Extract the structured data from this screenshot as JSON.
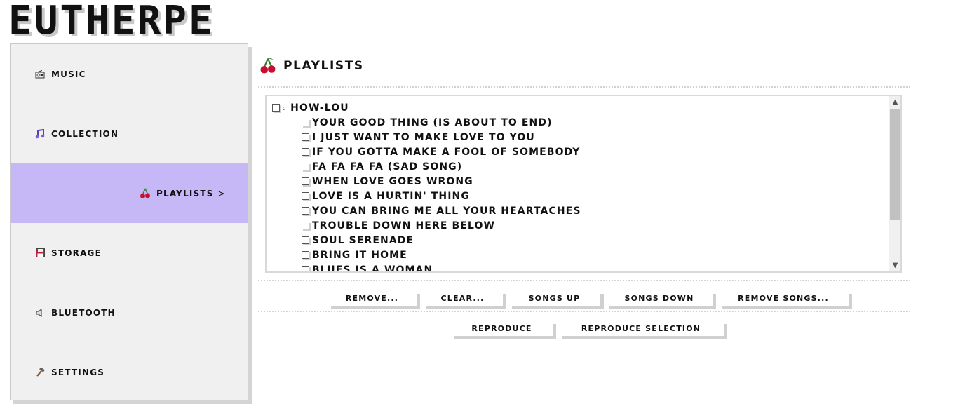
{
  "app": {
    "logo": "EUTHERPE"
  },
  "sidebar": {
    "items": [
      {
        "label": "Music",
        "icon": "radio-icon"
      },
      {
        "label": "Collection",
        "icon": "music-notes-icon"
      },
      {
        "label": "Playlists",
        "icon": "cherries-icon",
        "active": true,
        "arrow": ">"
      },
      {
        "label": "Storage",
        "icon": "floppy-disk-icon"
      },
      {
        "label": "Bluetooth",
        "icon": "speaker-icon"
      },
      {
        "label": "Settings",
        "icon": "hammer-icon"
      }
    ]
  },
  "main": {
    "title": "Playlists",
    "title_icon": "cherries-icon",
    "playlist": {
      "name": "How-Lou",
      "flat_glyph": "♭",
      "songs": [
        "Your Good Thing (Is About To End)",
        "I Just Want To Make Love To You",
        "If You Gotta Make A Fool Of Somebody",
        "Fa Fa Fa Fa (Sad Song)",
        "When Love Goes Wrong",
        "Love Is A Hurtin' Thing",
        "You Can Bring Me All Your Heartaches",
        "Trouble Down Here Below",
        "Soul Serenade",
        "Bring It Home",
        "Blues Is A Woman"
      ]
    },
    "buttons_row1": [
      "Remove...",
      "Clear...",
      "Songs Up",
      "Songs Down",
      "Remove Songs..."
    ],
    "buttons_row2": [
      "Reproduce",
      "Reproduce Selection"
    ]
  },
  "colors": {
    "active_nav": "#c6b8f7",
    "sidebar_bg": "#f0f0f0",
    "shadow": "#d0d0d0"
  }
}
